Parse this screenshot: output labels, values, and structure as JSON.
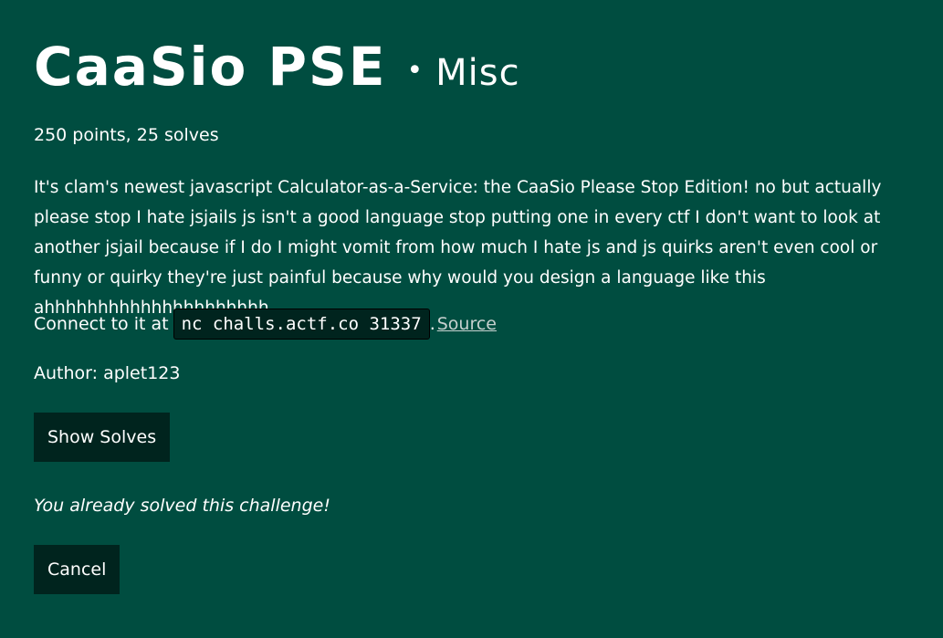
{
  "challenge": {
    "title": "CaaSio PSE",
    "separator": "•",
    "category": "Misc",
    "points_solves": "250 points, 25 solves",
    "description": "It's clam's newest javascript Calculator-as-a-Service: the CaaSio Please Stop Edition! no but actually please stop I hate jsjails js isn't a good language stop putting one in every ctf I don't want to look at another jsjail because if I do I might vomit from how much I hate js and js quirks aren't even cool or funny or quirky they're just painful because why would you design a language like this ahhhhhhhhhhhhhhhhhhhhh",
    "connect_prefix": "Connect to it at",
    "connect_command": "nc challs.actf.co 31337",
    "connect_period": ".",
    "source_link": "Source",
    "author": "Author: aplet123"
  },
  "actions": {
    "show_solves_label": "Show Solves",
    "solved_message": "You already solved this challenge!",
    "cancel_label": "Cancel"
  },
  "colors": {
    "background": "#004d40",
    "button_bg": "#00241e",
    "text": "#ffffff",
    "link": "#c6d0ce"
  }
}
